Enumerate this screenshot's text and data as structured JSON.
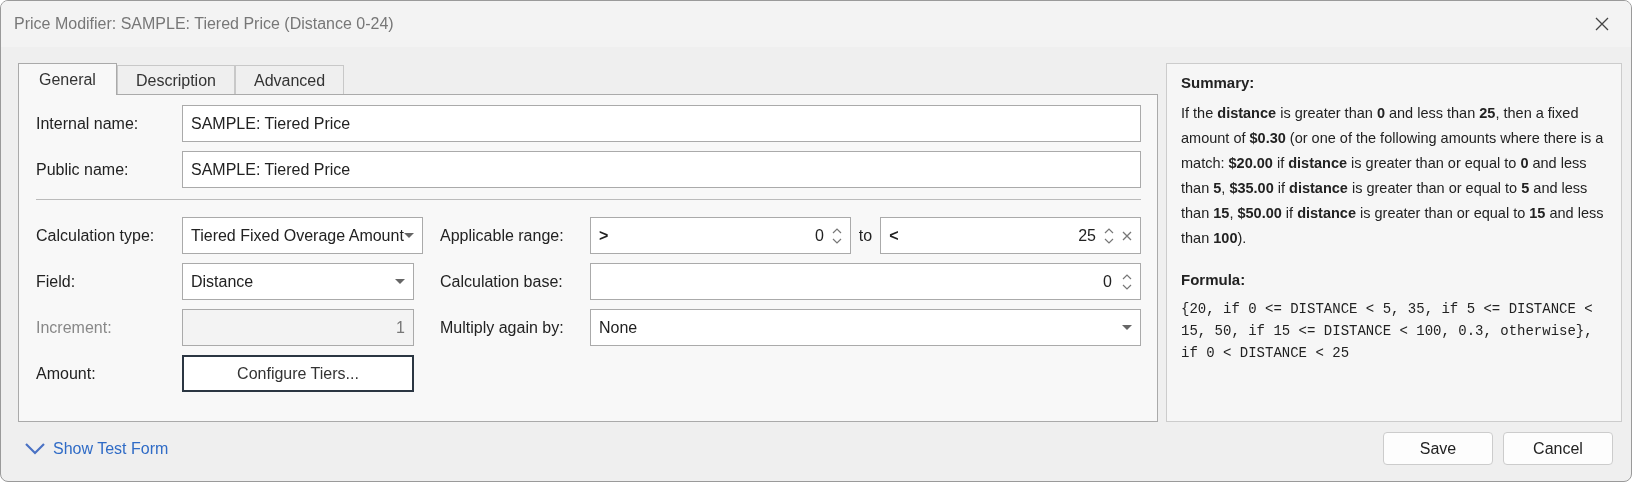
{
  "window": {
    "title": "Price Modifier: SAMPLE: Tiered Price (Distance 0-24)"
  },
  "tabs": [
    {
      "label": "General",
      "selected": true
    },
    {
      "label": "Description",
      "selected": false
    },
    {
      "label": "Advanced",
      "selected": false
    }
  ],
  "name_fields": [
    {
      "label": "Internal name:",
      "value": "SAMPLE: Tiered Price"
    },
    {
      "label": "Public name:",
      "value": "SAMPLE: Tiered Price"
    }
  ],
  "left_fields": [
    {
      "kind": "dropdown",
      "label": "Calculation type:",
      "value": "Tiered Fixed Overage Amount",
      "disabled": false
    },
    {
      "kind": "dropdown",
      "label": "Field:",
      "value": "Distance",
      "disabled": false
    },
    {
      "kind": "number",
      "label": "Increment:",
      "value": "1",
      "disabled": true
    },
    {
      "kind": "button",
      "label": "Amount:",
      "value": "Configure Tiers...",
      "disabled": false
    }
  ],
  "right_fields": [
    {
      "kind": "range",
      "label": "Applicable range:",
      "from": {
        "operator": ">",
        "value": "0"
      },
      "joiner": "to",
      "to": {
        "operator": "<",
        "value": "25"
      }
    },
    {
      "kind": "spinner",
      "label": "Calculation base:",
      "value": "0"
    },
    {
      "kind": "dropdown",
      "label": "Multiply again by:",
      "value": "None"
    }
  ],
  "summary": {
    "title": "Summary:",
    "text": "If the **distance** is greater than **0** and less than **25**, then a fixed amount of **$0.30** (or one of the following amounts where there is a match: **$20.00** if **distance** is greater than or equal to **0** and less than **5**, **$35.00** if **distance** is greater than or equal to **5** and less than **15**, **$50.00** if **distance** is greater than or equal to **15** and less than **100**)."
  },
  "formula": {
    "title": "Formula:",
    "text": "{20, if 0 <= DISTANCE < 5, 35, if 5 <= DISTANCE < 15, 50, if 15 <= DISTANCE < 100, 0.3, otherwise}, if 0 < DISTANCE < 25"
  },
  "footer": {
    "link": "Show Test Form",
    "buttons": [
      "Save",
      "Cancel"
    ]
  }
}
